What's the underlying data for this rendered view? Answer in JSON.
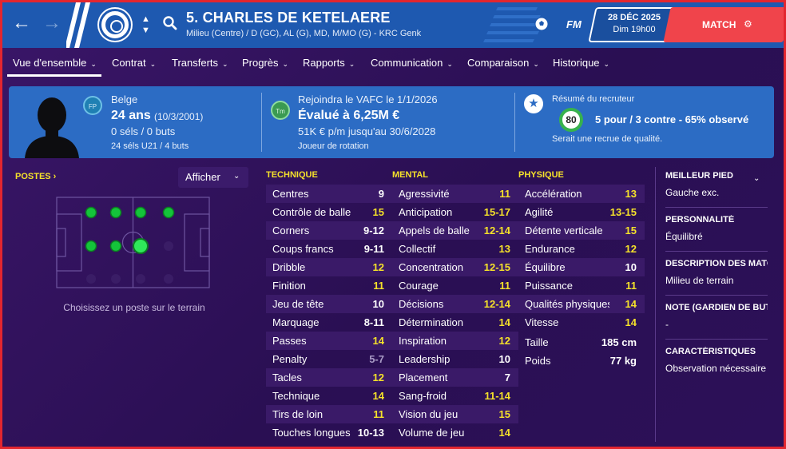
{
  "header": {
    "player_name": "5. CHARLES DE KETELAERE",
    "player_positions": "Milieu (Centre) / D (GC), AL (G), MD, M/MO (G) - KRC Genk",
    "back_icon": "arrow-left-icon",
    "forward_icon": "arrow-right-icon",
    "fm_logo": "FM",
    "date": "28 DÉC 2025",
    "time": "Dim 19h00",
    "match_label": "MATCH",
    "colors": {
      "bar": "#1e59b0",
      "match": "#f0444b"
    }
  },
  "tabs": [
    {
      "label": "Vue d'ensemble"
    },
    {
      "label": "Contrat"
    },
    {
      "label": "Transferts"
    },
    {
      "label": "Progrès"
    },
    {
      "label": "Rapports"
    },
    {
      "label": "Communication"
    },
    {
      "label": "Comparaison"
    },
    {
      "label": "Historique"
    }
  ],
  "info": {
    "nationality": "Belge",
    "age": "24 ans",
    "birth": "(10/3/2001)",
    "caps": "0 séls / 0 buts",
    "u21": "24 séls U21 / 4 buts",
    "nat_badge": "FP",
    "join": "Rejoindra le VAFC le 1/1/2026",
    "value": "Évalué à 6,25M €",
    "wage": "51K € p/m jusqu'au 30/6/2028",
    "role": "Joueur de rotation",
    "club_badge": "Tm",
    "scout_title": "Résumé du recruteur",
    "scout_rating": "80",
    "scout_summary": "5 pour / 3 contre - 65% observé",
    "scout_verdict": "Serait une recrue de qualité."
  },
  "left": {
    "postes": "POSTES",
    "afficher": "Afficher",
    "hint": "Choisissez un poste sur le terrain"
  },
  "technique": {
    "title": "TECHNIQUE",
    "rows": [
      {
        "label": "Centres",
        "value": "9",
        "tone": "mid"
      },
      {
        "label": "Contrôle de balle",
        "value": "15",
        "tone": "high"
      },
      {
        "label": "Corners",
        "value": "9-12",
        "tone": "mid"
      },
      {
        "label": "Coups francs",
        "value": "9-11",
        "tone": "mid"
      },
      {
        "label": "Dribble",
        "value": "12",
        "tone": "high"
      },
      {
        "label": "Finition",
        "value": "11",
        "tone": "high"
      },
      {
        "label": "Jeu de tête",
        "value": "10",
        "tone": "mid"
      },
      {
        "label": "Marquage",
        "value": "8-11",
        "tone": "mid"
      },
      {
        "label": "Passes",
        "value": "14",
        "tone": "high"
      },
      {
        "label": "Penalty",
        "value": "5-7",
        "tone": "low"
      },
      {
        "label": "Tacles",
        "value": "12",
        "tone": "high"
      },
      {
        "label": "Technique",
        "value": "14",
        "tone": "high"
      },
      {
        "label": "Tirs de loin",
        "value": "11",
        "tone": "high"
      },
      {
        "label": "Touches longues",
        "value": "10-13",
        "tone": "mid"
      }
    ]
  },
  "mental": {
    "title": "MENTAL",
    "rows": [
      {
        "label": "Agressivité",
        "value": "11",
        "tone": "high"
      },
      {
        "label": "Anticipation",
        "value": "15-17",
        "tone": "high"
      },
      {
        "label": "Appels de balle",
        "value": "12-14",
        "tone": "high"
      },
      {
        "label": "Collectif",
        "value": "13",
        "tone": "high"
      },
      {
        "label": "Concentration",
        "value": "12-15",
        "tone": "high"
      },
      {
        "label": "Courage",
        "value": "11",
        "tone": "high"
      },
      {
        "label": "Décisions",
        "value": "12-14",
        "tone": "high"
      },
      {
        "label": "Détermination",
        "value": "14",
        "tone": "high"
      },
      {
        "label": "Inspiration",
        "value": "12",
        "tone": "high"
      },
      {
        "label": "Leadership",
        "value": "10",
        "tone": "mid"
      },
      {
        "label": "Placement",
        "value": "7",
        "tone": "mid"
      },
      {
        "label": "Sang-froid",
        "value": "11-14",
        "tone": "high"
      },
      {
        "label": "Vision du jeu",
        "value": "15",
        "tone": "high"
      },
      {
        "label": "Volume de jeu",
        "value": "14",
        "tone": "high"
      }
    ]
  },
  "physique": {
    "title": "PHYSIQUE",
    "rows": [
      {
        "label": "Accélération",
        "value": "13",
        "tone": "high"
      },
      {
        "label": "Agilité",
        "value": "13-15",
        "tone": "high"
      },
      {
        "label": "Détente verticale",
        "value": "15",
        "tone": "high"
      },
      {
        "label": "Endurance",
        "value": "12",
        "tone": "high"
      },
      {
        "label": "Équilibre",
        "value": "10",
        "tone": "mid"
      },
      {
        "label": "Puissance",
        "value": "11",
        "tone": "high"
      },
      {
        "label": "Qualités physiques",
        "value": "14",
        "tone": "high"
      },
      {
        "label": "Vitesse",
        "value": "14",
        "tone": "high"
      }
    ],
    "height_label": "Taille",
    "height_value": "185 cm",
    "weight_label": "Poids",
    "weight_value": "77 kg"
  },
  "right_panel": {
    "foot_title": "MEILLEUR PIED",
    "foot_value": "Gauche exc.",
    "personality_title": "PERSONNALITÉ",
    "personality_value": "Équilibré",
    "description_title": "DESCRIPTION DES MATCHS",
    "description_value": "Milieu de terrain",
    "gk_title": "NOTE (GARDIEN DE BUT)",
    "gk_value": "-",
    "traits_title": "CARACTÉRISTIQUES",
    "traits_value": "Observation nécessaire"
  }
}
